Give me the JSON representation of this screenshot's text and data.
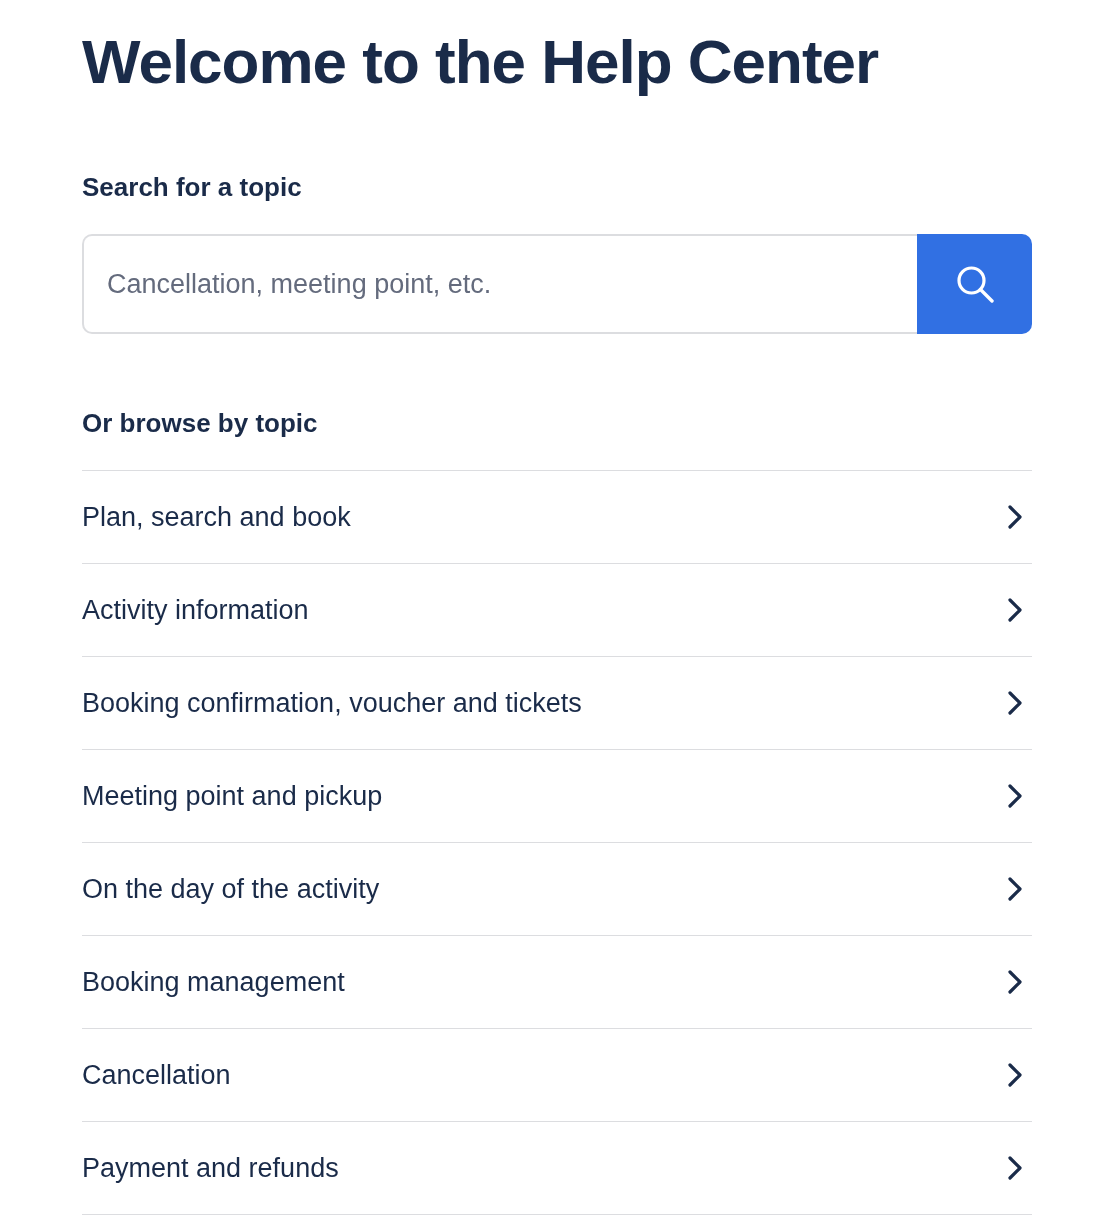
{
  "title": "Welcome to the Help Center",
  "search": {
    "label": "Search for a topic",
    "placeholder": "Cancellation, meeting point, etc."
  },
  "browse": {
    "heading": "Or browse by topic",
    "topics": [
      {
        "label": "Plan, search and book"
      },
      {
        "label": "Activity information"
      },
      {
        "label": "Booking confirmation, voucher and tickets"
      },
      {
        "label": "Meeting point and pickup"
      },
      {
        "label": "On the day of the activity"
      },
      {
        "label": "Booking management"
      },
      {
        "label": "Cancellation"
      },
      {
        "label": "Payment and refunds"
      }
    ]
  }
}
